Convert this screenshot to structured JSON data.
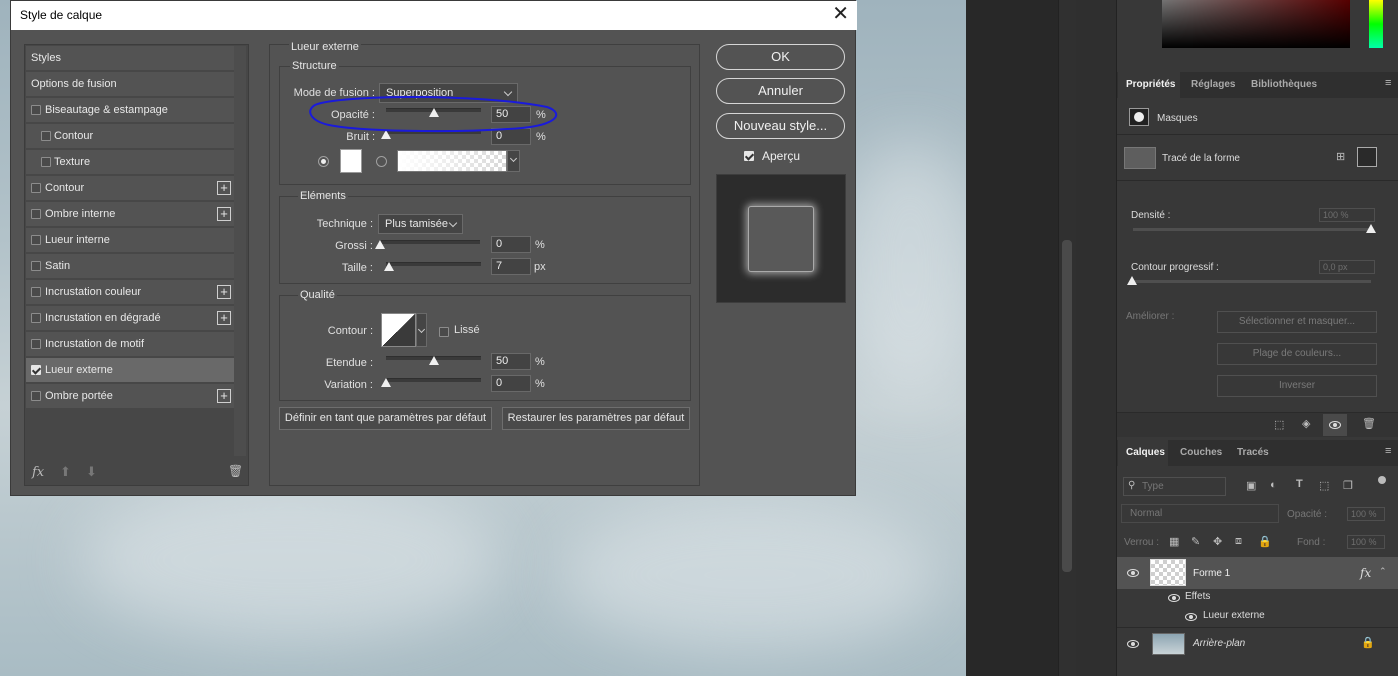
{
  "dialog": {
    "title": "Style de calque",
    "close": "✕"
  },
  "styles_list": [
    {
      "label": "Styles",
      "checkbox": false,
      "checked": false,
      "indent": false,
      "plus": false,
      "selected": false
    },
    {
      "label": "Options de fusion",
      "checkbox": false,
      "checked": false,
      "indent": false,
      "plus": false,
      "selected": false
    },
    {
      "label": "Biseautage & estampage",
      "checkbox": true,
      "checked": false,
      "indent": false,
      "plus": false,
      "selected": false
    },
    {
      "label": "Contour",
      "checkbox": true,
      "checked": false,
      "indent": true,
      "plus": false,
      "selected": false
    },
    {
      "label": "Texture",
      "checkbox": true,
      "checked": false,
      "indent": true,
      "plus": false,
      "selected": false
    },
    {
      "label": "Contour",
      "checkbox": true,
      "checked": false,
      "indent": false,
      "plus": true,
      "selected": false
    },
    {
      "label": "Ombre interne",
      "checkbox": true,
      "checked": false,
      "indent": false,
      "plus": true,
      "selected": false
    },
    {
      "label": "Lueur interne",
      "checkbox": true,
      "checked": false,
      "indent": false,
      "plus": false,
      "selected": false
    },
    {
      "label": "Satin",
      "checkbox": true,
      "checked": false,
      "indent": false,
      "plus": false,
      "selected": false
    },
    {
      "label": "Incrustation couleur",
      "checkbox": true,
      "checked": false,
      "indent": false,
      "plus": true,
      "selected": false
    },
    {
      "label": "Incrustation en dégradé",
      "checkbox": true,
      "checked": false,
      "indent": false,
      "plus": true,
      "selected": false
    },
    {
      "label": "Incrustation de motif",
      "checkbox": true,
      "checked": false,
      "indent": false,
      "plus": false,
      "selected": false
    },
    {
      "label": "Lueur externe",
      "checkbox": true,
      "checked": true,
      "indent": false,
      "plus": false,
      "selected": true
    },
    {
      "label": "Ombre portée",
      "checkbox": true,
      "checked": false,
      "indent": false,
      "plus": true,
      "selected": false
    }
  ],
  "list_footer": {
    "fx": "fx",
    "up": "⬆",
    "down": "⬇",
    "trash": "🗑"
  },
  "main": {
    "title": "Lueur externe",
    "structure": {
      "title": "Structure",
      "blend_label": "Mode de fusion :",
      "blend_value": "Superposition",
      "opacity_label": "Opacité :",
      "opacity_value": "50",
      "opacity_unit": "%",
      "opacity_level": 50,
      "noise_label": "Bruit :",
      "noise_value": "0",
      "noise_unit": "%",
      "noise_level": 0
    },
    "elements": {
      "title": "Eléments",
      "technique_label": "Technique :",
      "technique_value": "Plus tamisée",
      "spread_label": "Grossi :",
      "spread_value": "0",
      "spread_unit": "%",
      "spread_level": 0,
      "size_label": "Taille :",
      "size_value": "7",
      "size_unit": "px",
      "size_level": 3
    },
    "quality": {
      "title": "Qualité",
      "contour_label": "Contour :",
      "smooth_label": "Lissé",
      "range_label": "Etendue :",
      "range_value": "50",
      "range_unit": "%",
      "range_level": 50,
      "jitter_label": "Variation :",
      "jitter_value": "0",
      "jitter_unit": "%",
      "jitter_level": 0
    },
    "default_btn": "Définir en tant que paramètres par défaut",
    "reset_btn": "Restaurer les paramètres par défaut"
  },
  "actions": {
    "ok": "OK",
    "cancel": "Annuler",
    "new_style": "Nouveau style...",
    "preview": "Aperçu"
  },
  "properties": {
    "tabs": [
      "Propriétés",
      "Réglages",
      "Bibliothèques"
    ],
    "masks_label": "Masques",
    "shape_path_label": "Tracé de la forme",
    "density_label": "Densité :",
    "density_value": "100 %",
    "feather_label": "Contour progressif :",
    "feather_value": "0,0 px",
    "refine_label": "Améliorer :",
    "select_mask_btn": "Sélectionner et masquer...",
    "color_range_btn": "Plage de couleurs...",
    "invert_btn": "Inverser"
  },
  "layers": {
    "tabs": [
      "Calques",
      "Couches",
      "Tracés"
    ],
    "search_placeholder": "Type",
    "blend_mode": "Normal",
    "opacity_label": "Opacité :",
    "opacity_value": "100 %",
    "lock_label": "Verrou :",
    "fill_label": "Fond :",
    "fill_value": "100 %",
    "items": {
      "shape_layer": "Forme 1",
      "effects": "Effets",
      "outer_glow": "Lueur externe",
      "background": "Arrière-plan",
      "fx": "fx"
    }
  },
  "colors": {
    "accent_annotation": "#1a1adb",
    "dialog_bg": "#535353",
    "panel_bg": "#383838"
  }
}
